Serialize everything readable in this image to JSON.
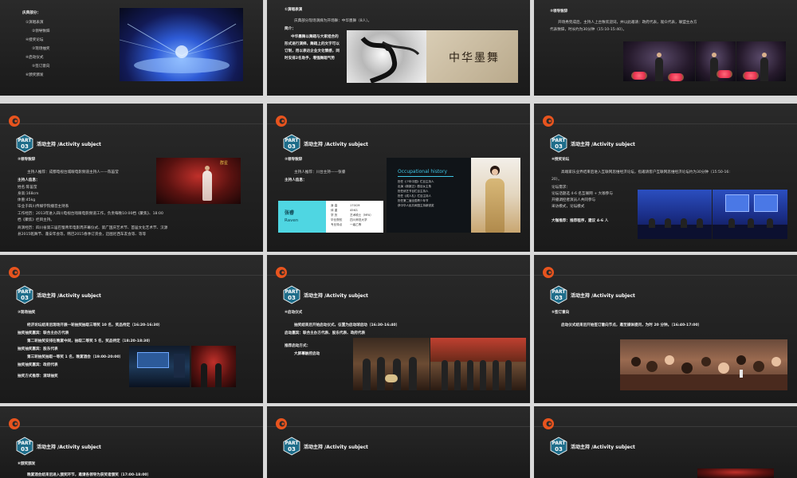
{
  "slides": [
    {
      "lines": [
        "庆典部分：",
        "①演唱表演",
        "②领导致辞",
        "④授奖论坛",
        "③现场抽奖",
        "④启动仪式",
        "⑤签订意向",
        "⑥颁奖颁发"
      ]
    },
    {
      "lines": [
        "①演唱表演",
        "庆典部分现场演绎为开场舞：中华墨舞（8人）。",
        "简介：",
        "中华墨舞以舞蹈与大家组合的",
        "形式进行演绎，舞蹈上的文字可以",
        "订制，用以表达企业文化情感，同",
        "时安排2名助手，增强舞蹈气势"
      ],
      "calligraphy": "中华墨舞"
    },
    {
      "lines": [
        "②领导致辞",
        "开场秀完成后，主持人上台致欢迎词，并以此邀请：政府代表，观众代表，联盟主办方",
        "代表致辞，时长约为30分钟（15:10-15:40）。"
      ]
    },
    {
      "part_label": "PART",
      "part_num": "03",
      "subject": "活动主持 /Activity subject",
      "lines": [
        "②领导致辞",
        "主持人推荐：成都电视台城眼电影频道主持人——陈笛莹",
        "主持人信息：",
        "姓名:陈笛莹",
        "身高:168cm",
        "体重:45kg",
        "毕业于四川传媒学院播音主持系",
        "工作经历：2013年进入四川电视台戏眼电影频道工作，负责每晚10:00档《聚焦》、18:00",
        "档《聚焦》栏目主持。",
        "商演经历：四川省第三届巴蜀青年电影周开幕仪式、第广国庆艺术节、首届文化艺术节、汉源",
        "县2015乾舞节、蓬安年会等，韩巴2015春季订货会，迈图尼西车友会等、等等"
      ],
      "screen_badge": "群星"
    },
    {
      "part_label": "PART",
      "part_num": "03",
      "subject": "活动主持 /Activity subject",
      "lines": [
        "②领导致辞",
        "主持人推荐：川台主持——张睿",
        "主持人信息："
      ],
      "name_cn": "张睿",
      "name_en": "Raven",
      "card_lines": [
        "身 高",
        "体 重",
        "学 历",
        "毕业院校",
        "专业特点"
      ],
      "card_values": [
        "170CM",
        "45KG",
        "艺术硕士（MFA）",
        "四川师范大学",
        "一级乙等"
      ],
      "history_title": "Occupational history",
      "history_lines": [
        "担任《少年中国》栏目主持人",
        "出演《新娘正》剧目女主角",
        "担任综艺节目栏目主持人",
        "担任《成人礼》栏目主持人",
        "担任第二届全国青少年节",
        "获中华人民共和国主持新锐奖"
      ]
    },
    {
      "part_label": "PART",
      "part_num": "03",
      "subject": "活动主持 /Activity subject",
      "lines": [
        "④授奖论坛",
        "高端家乐业界结束后进入互联网思维经济论坛，指邀请客户互联网思维经济论坛约为30分钟（15:50-16:",
        "20）。",
        "论坛需求：",
        "论坛话题选 4-6 名互联网 + 大咖参与",
        "开播调控者演员人共同参与",
        "采访模式，论坛模式",
        "大咖推荐：推荐程序，建议 4-6 人"
      ]
    },
    {
      "part_label": "PART",
      "part_num": "03",
      "subject": "活动主持 /Activity subject",
      "lines": [
        "③现场抽奖",
        "经济论坛结束后现场开展一轮抽奖抽取三等奖 10 名，奖品待定（16:20-16:30）",
        "抽奖抽奖嘉宾：联合主办方代表",
        "第二轮抽奖安排在晚宴中间，抽取二等奖 5 名，奖品待定（18:20-18:30）",
        "抽奖抽奖嘉宾：股东代表",
        "第三轮抽奖抽取一等奖 1 名，晚宴酒会（19:00-20:00）",
        "抽奖抽奖嘉宾：政府代表",
        "抽奖方式推荐：滚球抽奖"
      ]
    },
    {
      "part_label": "PART",
      "part_num": "03",
      "subject": "活动主持 /Activity subject",
      "lines": [
        "④启动仪式",
        "抽奖结束后开始启动仪式，征置为启动球启动（16:30-16:40）",
        "启动嘉宾：联合主办方代表、股东代表、政府代表",
        "推荐启动方式：",
        "大屏幕触控启动"
      ]
    },
    {
      "part_label": "PART",
      "part_num": "03",
      "subject": "活动主持 /Activity subject",
      "lines": [
        "⑤签订意向",
        "启动仪式结束后开始签订意向节点，邀至媒体提问，为时 20 分钟。（16:40-17:00）"
      ]
    },
    {
      "part_label": "PART",
      "part_num": "03",
      "subject": "活动主持 /Activity subject",
      "lines": [
        "⑥颁奖颁发",
        "晚宴酒会结束后进入颁奖环节，邀请各领导为获奖者颁奖（17:00-18:00）"
      ]
    },
    {
      "part_label": "PART",
      "part_num": "03",
      "subject": "活动主持 /Activity subject",
      "lines": []
    },
    {
      "part_label": "PART",
      "part_num": "03",
      "subject": "活动主持 /Activity subject",
      "lines": []
    }
  ],
  "colors": {
    "accent": "#e8541e",
    "part_badge": "#1e6d8a",
    "slide_bg": "#222222",
    "text": "#dcdcdc",
    "cyan_card": "#4fd6e2",
    "history_title": "#3ec6e6"
  },
  "icons": {
    "logo": "swirl-logo-icon",
    "badge": "hexagon-badge-icon"
  }
}
